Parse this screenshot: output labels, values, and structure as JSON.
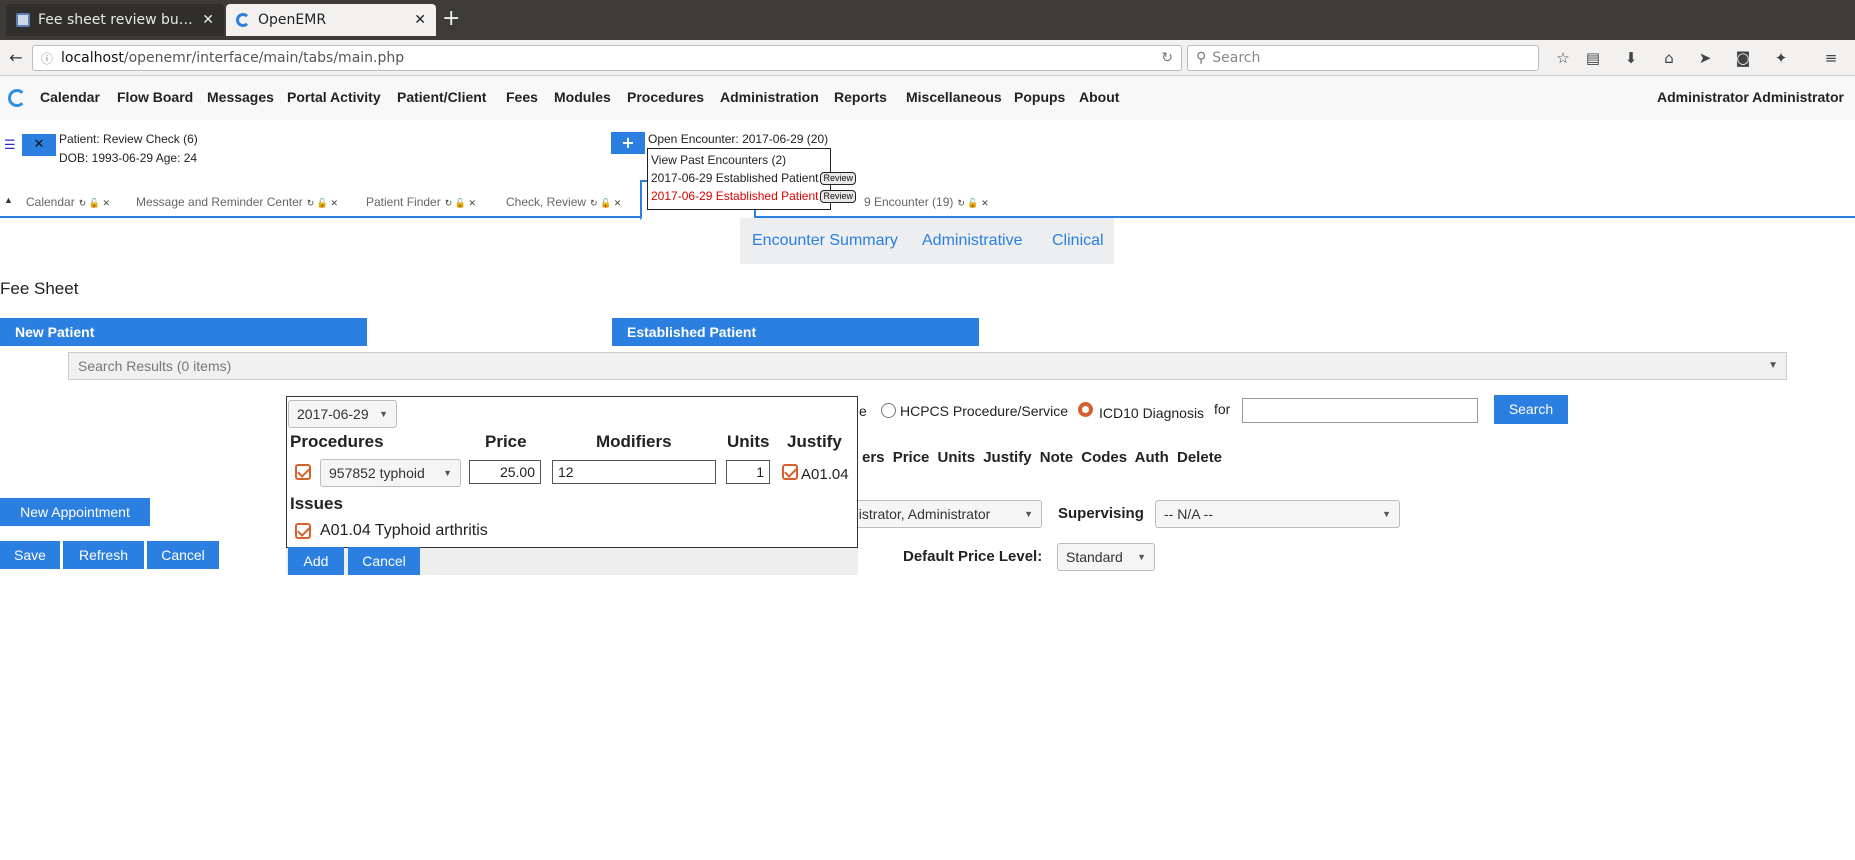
{
  "browser": {
    "tab1_title": "Fee sheet review bu…",
    "tab2_title": "OpenEMR",
    "url_host": "localhost",
    "url_path": "/openemr/interface/main/tabs/main.php",
    "search_placeholder": "Search"
  },
  "menu": {
    "items": [
      "Calendar",
      "Flow Board",
      "Messages",
      "Portal Activity",
      "Patient/Client",
      "Fees",
      "Modules",
      "Procedures",
      "Administration",
      "Reports",
      "Miscellaneous",
      "Popups",
      "About"
    ],
    "user": "Administrator Administrator"
  },
  "patient": {
    "name_label": "Patient:",
    "name": "Review Check (6)",
    "dob_line": "DOB: 1993-06-29 Age: 24"
  },
  "encounter": {
    "open_label": "Open Encounter:",
    "open_value": "2017-06-29 (20)",
    "past": "View Past Encounters (2)",
    "item1": "2017-06-29 Established Patient",
    "item2": "2017-06-29 Established Patient",
    "review": "Review"
  },
  "tabs": {
    "t1": "Calendar",
    "t2": "Message and Reminder Center",
    "t3": "Patient Finder",
    "t4": "Check, Review",
    "t6": "9 Encounter (19)"
  },
  "encnav": {
    "summary": "Encounter Summary",
    "admin": "Administrative",
    "clinical": "Clinical"
  },
  "page": {
    "title": "Fee Sheet",
    "new_patient": "New Patient",
    "established_patient": "Established Patient",
    "search_results": "Search Results (0 items)",
    "radio_cut": "e",
    "radio_hcpcs": "HCPCS Procedure/Service",
    "radio_icd10": "ICD10 Diagnosis",
    "for_label": "for",
    "search_btn": "Search",
    "col_headers": "ers Price Units Justify Note Codes Auth Delete",
    "new_appt": "New Appointment",
    "save": "Save",
    "refresh": "Refresh",
    "cancel": "Cancel",
    "rendering_value": "nistrator, Administrator",
    "supervising_label": "Supervising",
    "supervising_value": "-- N/A --",
    "price_level_label": "Default Price Level:",
    "price_level_value": "Standard"
  },
  "dialog": {
    "date": "2017-06-29",
    "h_procedures": "Procedures",
    "h_price": "Price",
    "h_modifiers": "Modifiers",
    "h_units": "Units",
    "h_justify": "Justify",
    "proc_select": "957852 typhoid",
    "price": "25.00",
    "modifiers": "12",
    "units": "1",
    "justify_code": "A01.04",
    "issues_label": "Issues",
    "issue": "A01.04 Typhoid arthritis",
    "add": "Add",
    "cancel": "Cancel"
  },
  "colors": {
    "accent": "#2a7fe0",
    "checkbox": "#d5622e",
    "warn": "#dd0000"
  }
}
